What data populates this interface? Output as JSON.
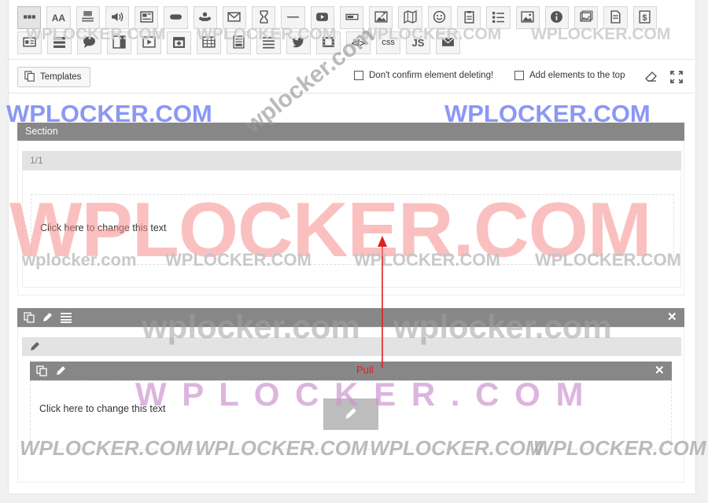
{
  "toolbar": {
    "row1": [
      {
        "icon": "row-icon"
      },
      {
        "icon": "text-size-icon",
        "text": "AA"
      },
      {
        "icon": "text-block-icon"
      },
      {
        "icon": "audio-icon"
      },
      {
        "icon": "post-icon"
      },
      {
        "icon": "button-icon"
      },
      {
        "icon": "network-icon"
      },
      {
        "icon": "mail-icon"
      },
      {
        "icon": "hourglass-icon"
      },
      {
        "icon": "divider-icon"
      },
      {
        "icon": "youtube-icon"
      },
      {
        "icon": "slider-bar-icon"
      },
      {
        "icon": "image-edit-icon"
      },
      {
        "icon": "map-icon"
      },
      {
        "icon": "smiley-icon"
      },
      {
        "icon": "clipboard-icon"
      },
      {
        "icon": "list-icon"
      },
      {
        "icon": "image-icon"
      },
      {
        "icon": "info-icon"
      },
      {
        "icon": "gallery-icon"
      },
      {
        "icon": "document-icon"
      },
      {
        "icon": "dollar-icon"
      }
    ],
    "row2": [
      {
        "icon": "card-icon"
      },
      {
        "icon": "stack-icon"
      },
      {
        "icon": "comment-icon"
      },
      {
        "icon": "sidebar-icon"
      },
      {
        "icon": "video-player-icon"
      },
      {
        "icon": "calendar-icon"
      },
      {
        "icon": "table-icon"
      },
      {
        "icon": "form-icon"
      },
      {
        "icon": "lines-icon"
      },
      {
        "icon": "twitter-icon"
      },
      {
        "icon": "film-icon"
      },
      {
        "icon": "code-icon",
        "text": "</>"
      },
      {
        "icon": "css-icon",
        "text": "CSS"
      },
      {
        "icon": "js-icon",
        "text": "JS"
      },
      {
        "icon": "envelope-icon"
      }
    ]
  },
  "templates_label": "Templates",
  "confirm_delete_label": "Don't confirm element deleting!",
  "add_top_label": "Add elements to the top",
  "section": {
    "title": "Section",
    "column_label": "1/1",
    "text": "Click here to change this text"
  },
  "row2": {
    "text": "Click here to change this text"
  },
  "annotation": {
    "pull_label": "Pull"
  },
  "watermarks": {
    "top_row": "WPLOCKER.COM",
    "left_blue": "WPLOCKER.COM",
    "right_blue": "WPLOCKER.COM",
    "center_rotated": "wplocker.com",
    "big_red": "WPLOCKER.COM",
    "mid_small": "wplocker.com",
    "mid_caps": "WPLOCKER.COM",
    "gray_lower": "wplocker.com",
    "spaced_purple": "W P L O C K E R . C O M",
    "bottom_italic": "WPLOCKER.COM"
  },
  "colors": {
    "header_gray": "#878787",
    "annotation_red": "#e02020",
    "watermark_red": "#f5a3a3",
    "watermark_blue": "#7f8ff0",
    "watermark_purple": "#d6a8d9"
  }
}
